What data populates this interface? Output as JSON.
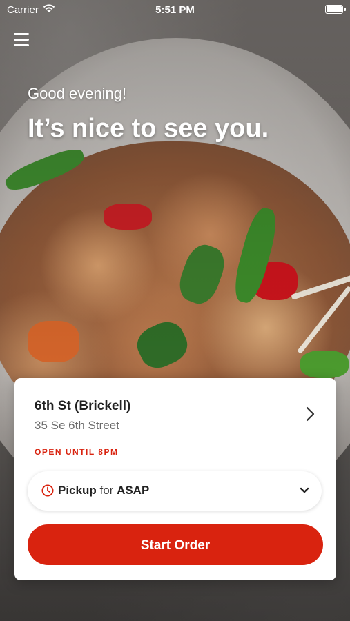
{
  "status_bar": {
    "carrier": "Carrier",
    "time": "5:51 PM"
  },
  "header": {
    "greeting": "Good evening!",
    "headline": "It’s nice to see you."
  },
  "location": {
    "name": "6th St (Brickell)",
    "address": "35 Se 6th Street",
    "hours": "OPEN UNTIL 8PM"
  },
  "order_type": {
    "mode": "Pickup",
    "connector": "for",
    "time": "ASAP"
  },
  "actions": {
    "start_order": "Start Order"
  },
  "colors": {
    "accent": "#d9230f",
    "card_bg": "#ffffff",
    "text_primary": "#222222",
    "text_secondary": "#6b6b6b"
  },
  "icons": {
    "menu": "hamburger-menu-icon",
    "location_arrow": "chevron-right-icon",
    "clock": "clock-icon",
    "dropdown": "chevron-down-icon",
    "wifi": "wifi-icon",
    "battery": "battery-icon"
  }
}
